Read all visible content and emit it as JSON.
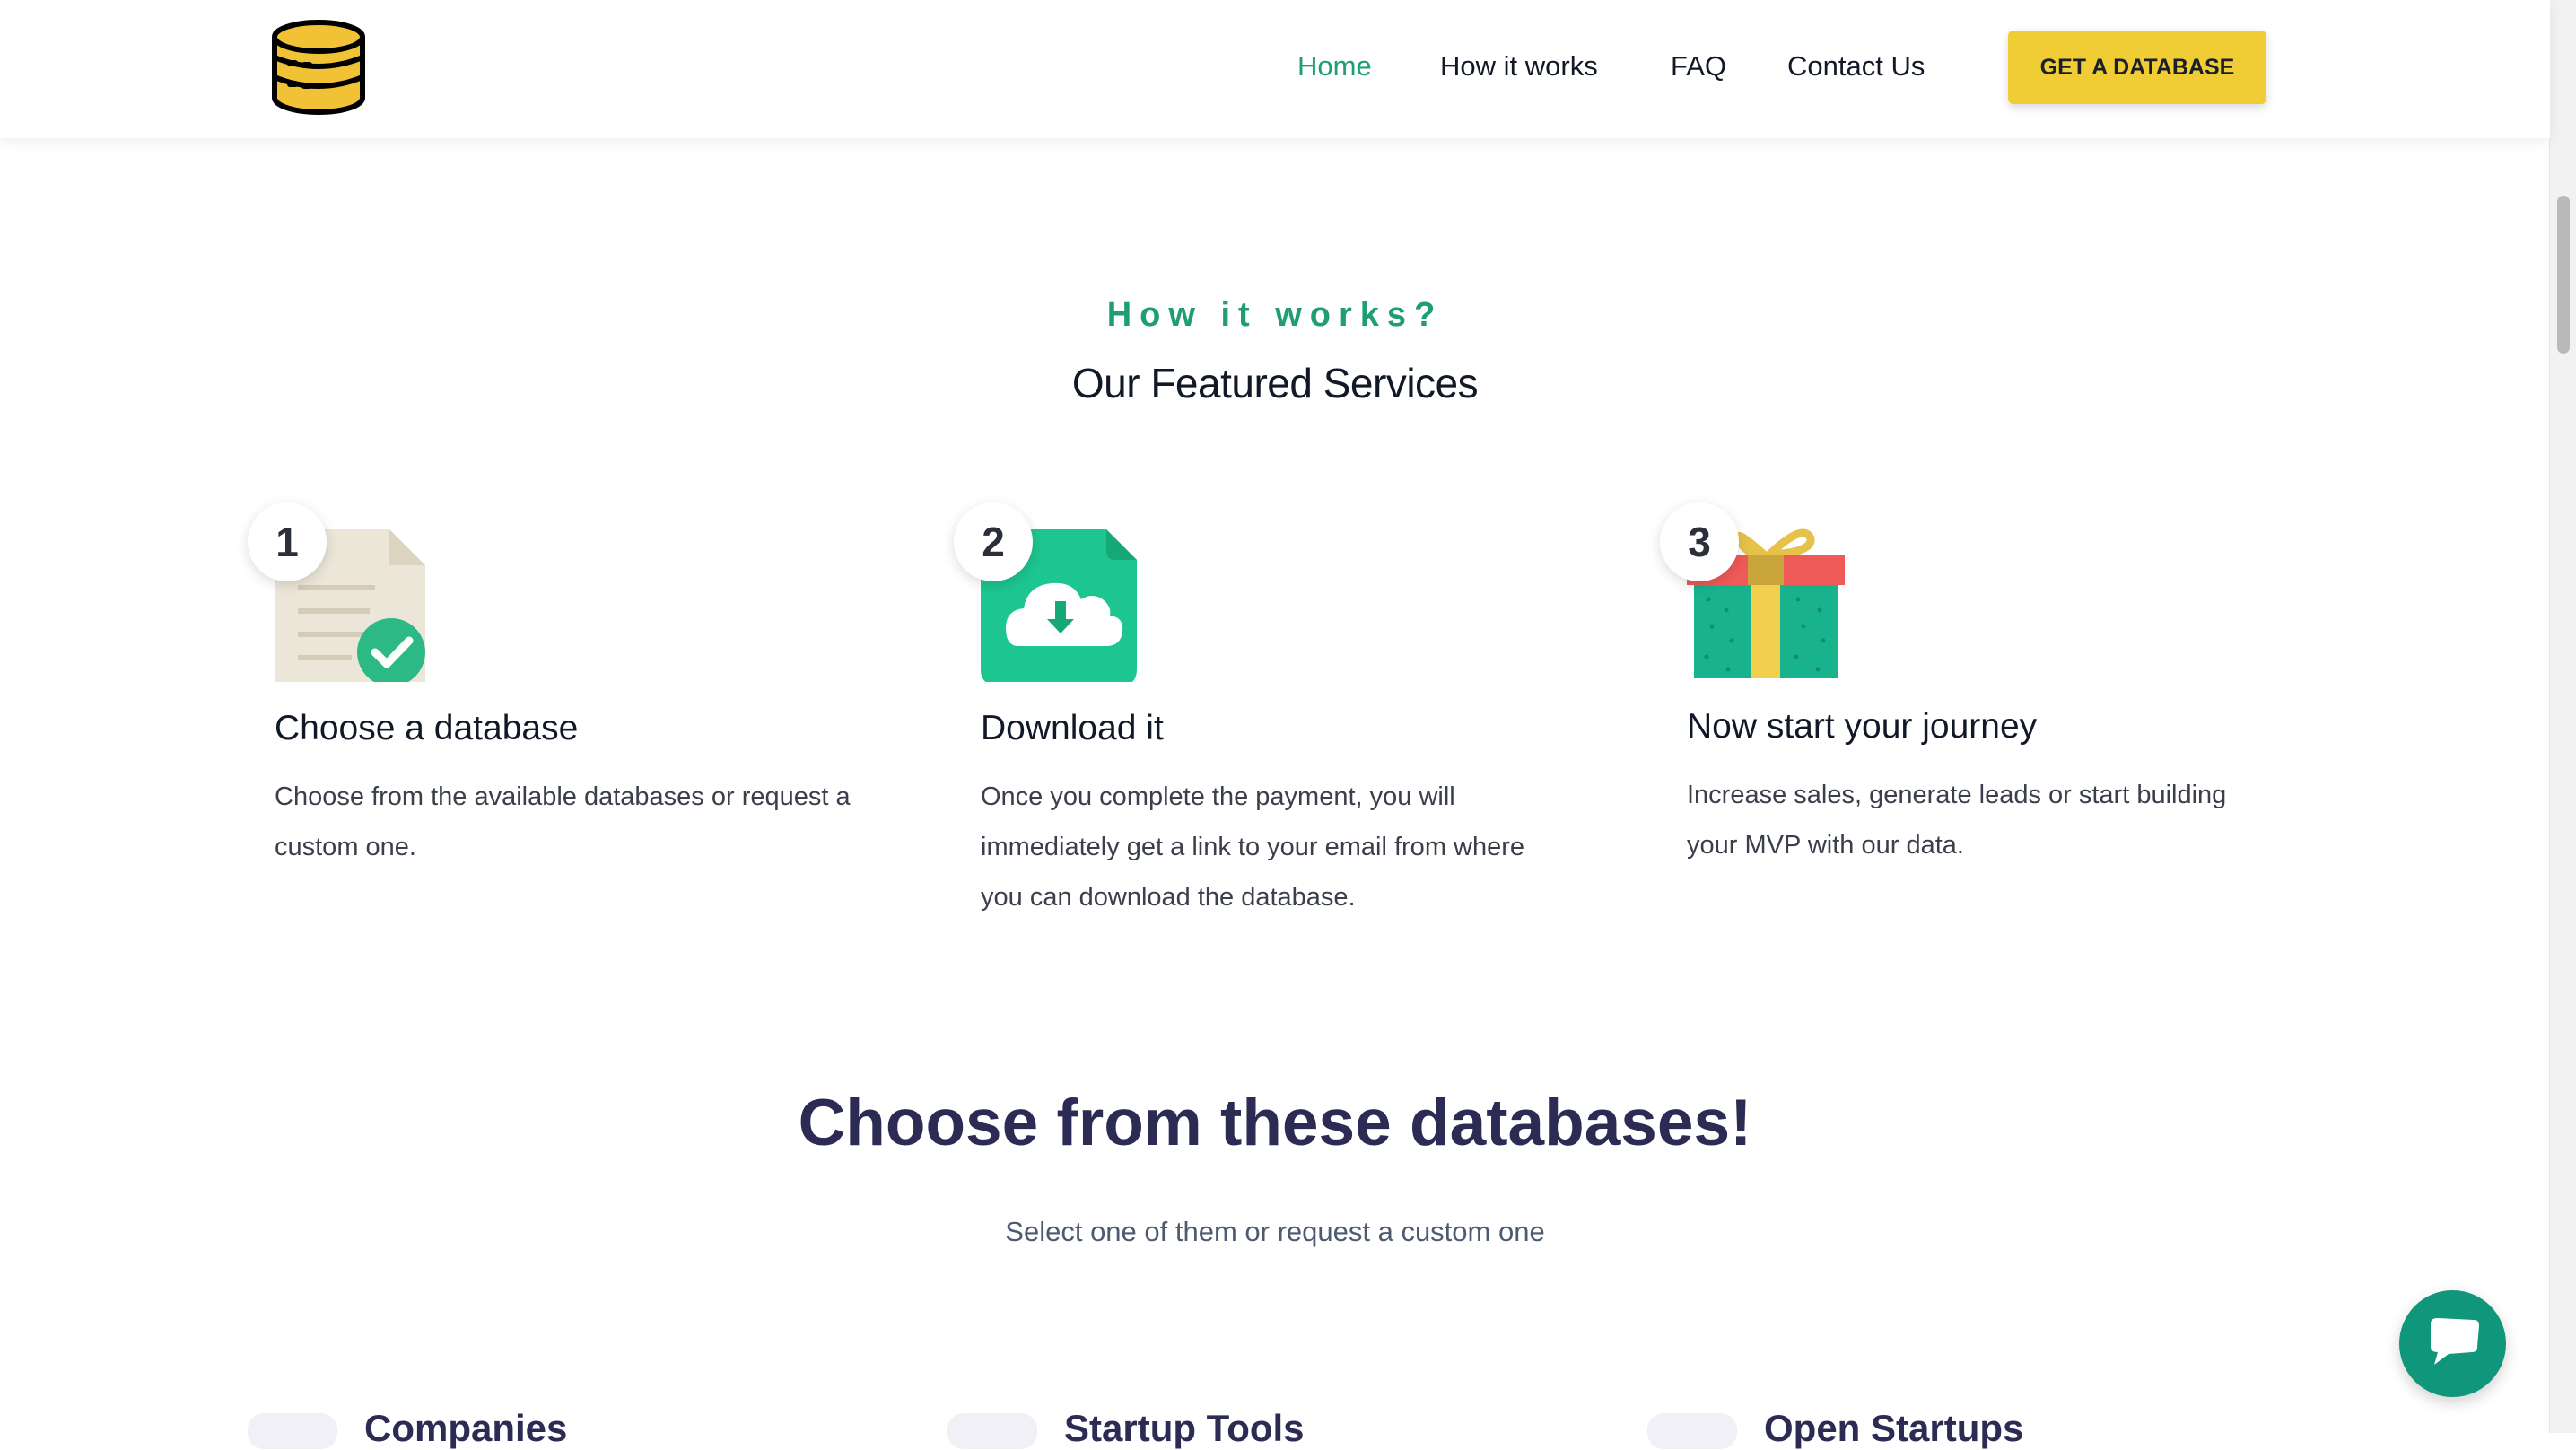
{
  "nav": {
    "items": [
      {
        "label": "Home"
      },
      {
        "label": "How it works"
      },
      {
        "label": "FAQ"
      },
      {
        "label": "Contact Us"
      }
    ],
    "cta_label": "GET A DATABASE",
    "logo_icon": "database-stack-icon"
  },
  "how": {
    "eyebrow": "How it works?",
    "title": "Our Featured Services",
    "steps": [
      {
        "number": "1",
        "icon": "document-check-icon",
        "title": "Choose a database",
        "desc": "Choose from the available databases or request a custom one."
      },
      {
        "number": "2",
        "icon": "cloud-download-file-icon",
        "title": "Download it",
        "desc": "Once you complete the payment, you will immediately get a link to your email from where you can download the database."
      },
      {
        "number": "3",
        "icon": "gift-box-icon",
        "title": "Now start your journey",
        "desc": "Increase sales, generate leads or start building your MVP with our data."
      }
    ]
  },
  "databases": {
    "title": "Choose from these databases!",
    "subtitle": "Select one of them or request a custom one",
    "cards": [
      {
        "title": "Companies"
      },
      {
        "title": "Startup Tools"
      },
      {
        "title": "Open Startups"
      }
    ]
  },
  "colors": {
    "accent_green": "#1f9e72",
    "cta_yellow": "#f0cd35",
    "heading_navy": "#2c2b54",
    "chat_teal": "#10967a"
  },
  "chat_icon": "chat-bubble-icon"
}
